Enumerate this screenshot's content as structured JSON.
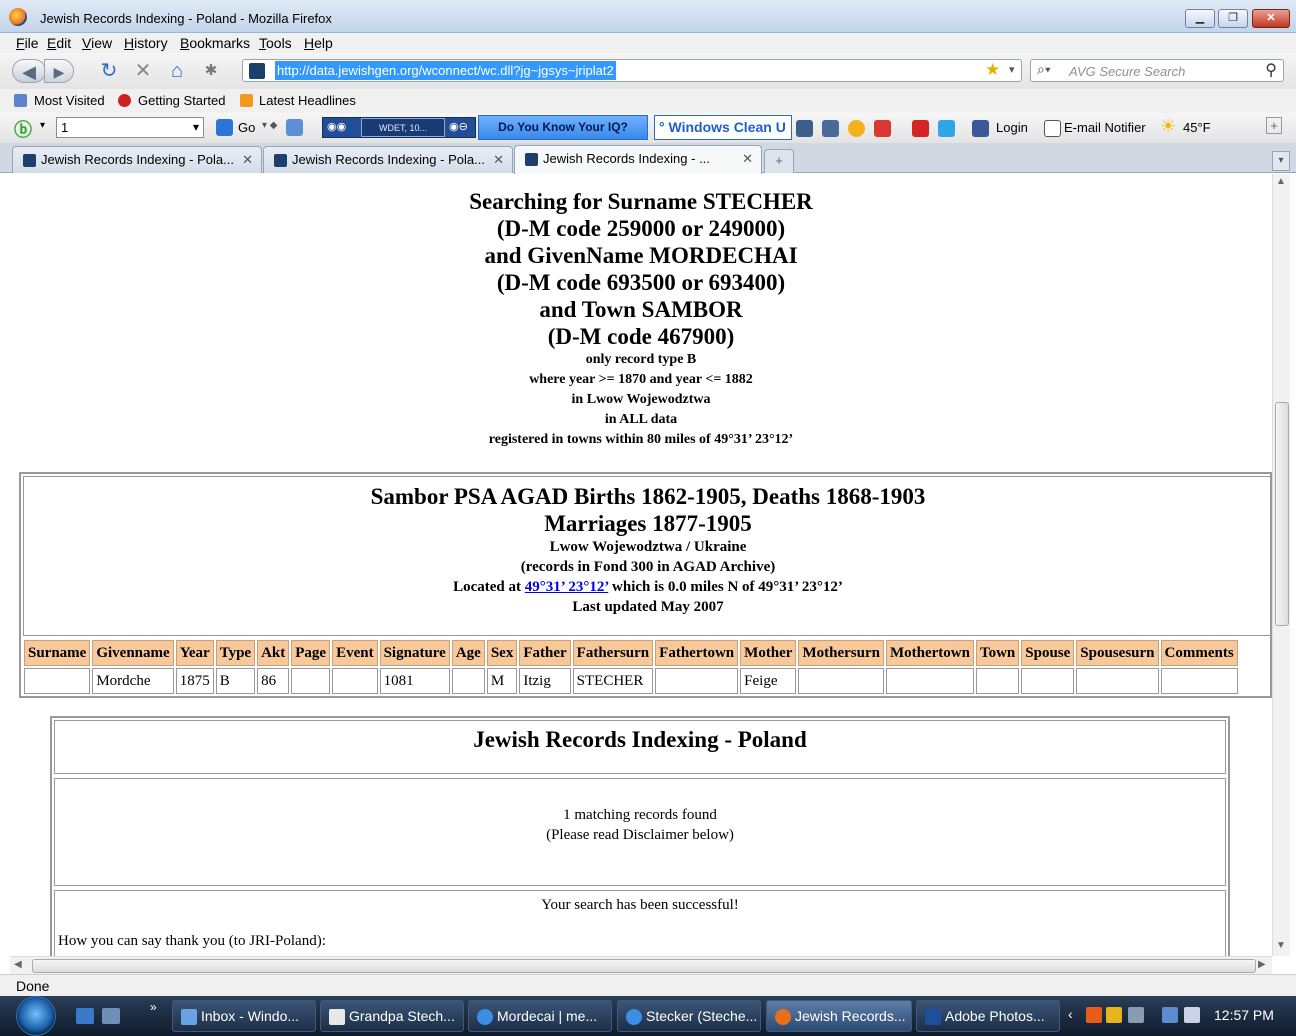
{
  "window": {
    "title": "Jewish Records Indexing - Poland - Mozilla Firefox"
  },
  "menu": [
    "File",
    "Edit",
    "View",
    "History",
    "Bookmarks",
    "Tools",
    "Help"
  ],
  "nav": {
    "url": "http://data.jewishgen.org/wconnect/wc.dll?jg~jgsys~jriplat2",
    "search_placeholder": "AVG Secure Search"
  },
  "bookmarks": [
    "Most Visited",
    "Getting Started",
    "Latest Headlines"
  ],
  "toolbar": {
    "combo_value": "1",
    "go_label": "Go",
    "player_text": "WDET, 10...",
    "iq_label": "Do You Know Your IQ?",
    "windows_clean_label": "° Windows Clean U",
    "login_label": "Login",
    "email_label": "E-mail Notifier",
    "weather": "45°F"
  },
  "tabs": [
    {
      "label": "Jewish Records Indexing - Pola..."
    },
    {
      "label": "Jewish Records Indexing - Pola..."
    },
    {
      "label": "Jewish Records Indexing - ..."
    }
  ],
  "search": {
    "lines_big": [
      "Searching for Surname STECHER",
      "(D-M code 259000 or 249000)",
      "and GivenName MORDECHAI",
      "(D-M code 693500 or 693400)",
      "and Town SAMBOR",
      "(D-M code 467900)"
    ],
    "lines_small": [
      "only record type B",
      "where year >= 1870 and year <= 1882",
      "in Lwow Wojewodztwa",
      "in ALL data",
      "registered in towns within 80 miles of 49°31’ 23°12’"
    ]
  },
  "database": {
    "title1": "Sambor PSA AGAD Births 1862-1905, Deaths 1868-1903",
    "title2": "Marriages 1877-1905",
    "region": "Lwow Wojewodztwa / Ukraine",
    "fond": "(records in Fond 300 in AGAD Archive)",
    "located_prefix": "Located at",
    "located_link": "49°31’ 23°12’",
    "located_suffix": "which is 0.0 miles N of 49°31’ 23°12’",
    "updated": "Last updated May 2007"
  },
  "table": {
    "headers": [
      "Surname",
      "Givenname",
      "Year",
      "Type",
      "Akt",
      "Page",
      "Event",
      "Signature",
      "Age",
      "Sex",
      "Father",
      "Fathersurn",
      "Fathertown",
      "Mother",
      "Mothersurn",
      "Mothertown",
      "Town",
      "Spouse",
      "Spousesurn",
      "Comments"
    ],
    "rows": [
      [
        "",
        "Mordche",
        "1875",
        "B",
        "86",
        "",
        "",
        "1081",
        "",
        "M",
        "Itzig",
        "STECHER",
        "",
        "Feige",
        "",
        "",
        "",
        "",
        "",
        ""
      ]
    ]
  },
  "jri": {
    "title": "Jewish Records Indexing - Poland",
    "found": "1 matching records found",
    "disclaimer": "(Please read Disclaimer below)",
    "success": "Your search has been successful!",
    "thanks": "How you can say thank you (to JRI-Poland):"
  },
  "status": "Done",
  "taskbar": {
    "tasks": [
      "Inbox - Windo...",
      "Grandpa Stech...",
      "Mordecai | me...",
      "Stecker (Steche...",
      "Jewish Records...",
      "Adobe Photos..."
    ],
    "time": "12:57 PM"
  }
}
